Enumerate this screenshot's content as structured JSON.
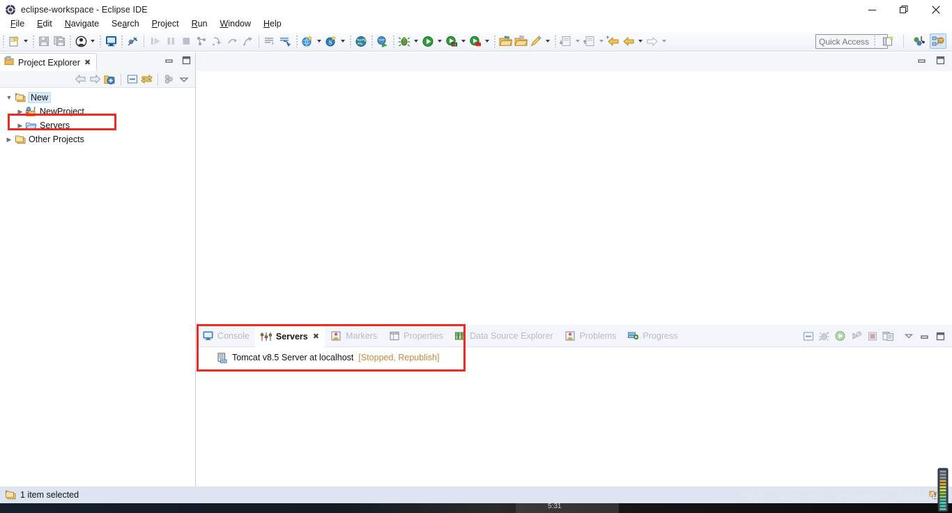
{
  "window": {
    "title": "eclipse-workspace - Eclipse IDE",
    "app_icon": "eclipse-icon",
    "minimize_label": "Minimize",
    "maximize_label": "Restore",
    "close_label": "Close"
  },
  "menu": {
    "items": [
      {
        "label": "File",
        "mnemonic": "F"
      },
      {
        "label": "Edit",
        "mnemonic": "E"
      },
      {
        "label": "Navigate",
        "mnemonic": "N"
      },
      {
        "label": "Search",
        "mnemonic": "a"
      },
      {
        "label": "Project",
        "mnemonic": "P"
      },
      {
        "label": "Run",
        "mnemonic": "R"
      },
      {
        "label": "Window",
        "mnemonic": "W"
      },
      {
        "label": "Help",
        "mnemonic": "H"
      }
    ]
  },
  "toolbar": {
    "quick_access_placeholder": "Quick Access",
    "quick_access_value": "",
    "items": [
      "new-wizard-icon",
      "new-dropdown-arrow",
      "save-icon",
      "save-all-icon",
      "user-icon",
      "user-dropdown-arrow",
      "open-console-icon",
      "toggle-breakpoint-icon",
      "resume-icon",
      "suspend-icon",
      "terminate-icon",
      "disconnect-icon",
      "step-into-icon",
      "step-over-icon",
      "step-return-icon",
      "skip-all-breakpoints-icon",
      "drop-to-frame-icon",
      "new-java-project-icon",
      "new-java-project-arrow",
      "new-servlet-icon",
      "new-servlet-arrow",
      "open-web-browser-icon",
      "run-web-app-icon",
      "debug-icon",
      "debug-arrow",
      "run-icon",
      "run-arrow",
      "run-server-icon",
      "run-server-arrow",
      "profile-icon",
      "profile-arrow",
      "new-folder-icon",
      "open-type-icon",
      "search-icon",
      "search-arrow",
      "next-annotation-icon",
      "next-annotation-arrow",
      "previous-annotation-icon",
      "previous-annotation-arrow",
      "back-icon",
      "back-arrow",
      "forward-icon",
      "forward-arrow"
    ],
    "perspective_buttons": [
      "open-perspective-icon",
      "java-ee-perspective-icon",
      "web-perspective-icon"
    ]
  },
  "project_explorer": {
    "tab_label": "Project Explorer",
    "tab_icon": "project-explorer-icon",
    "tab_close_label": "✖",
    "view_buttons": [
      "minimize-view-icon",
      "maximize-view-icon"
    ],
    "toolbar_buttons": [
      "back-navigation-icon",
      "forward-navigation-icon",
      "collapse-home-icon",
      "collapse-all-icon",
      "link-with-editor-icon",
      "view-menu-filters-icon",
      "view-menu-icon"
    ],
    "tree": [
      {
        "label": "New",
        "icon": "working-set-icon",
        "expanded": true,
        "indent": 0,
        "selected": true,
        "twisty": "v"
      },
      {
        "label": "NewProject",
        "icon": "dynamic-web-project-icon",
        "expanded": false,
        "indent": 1,
        "selected": false,
        "twisty": ">"
      },
      {
        "label": "Servers",
        "icon": "servers-folder-icon",
        "expanded": false,
        "indent": 1,
        "selected": false,
        "twisty": ">",
        "highlight": true
      },
      {
        "label": "Other Projects",
        "icon": "working-set-icon",
        "expanded": false,
        "indent": 0,
        "selected": false,
        "twisty": ">"
      }
    ]
  },
  "editor_area": {
    "buttons": [
      "minimize-editor-icon",
      "maximize-editor-icon"
    ]
  },
  "bottom_panel": {
    "tabs": [
      {
        "label": "Console",
        "icon": "console-icon",
        "active": false,
        "closable": false
      },
      {
        "label": "Servers",
        "icon": "servers-view-icon",
        "active": true,
        "closable": true
      },
      {
        "label": "Markers",
        "icon": "markers-icon",
        "active": false,
        "closable": false
      },
      {
        "label": "Properties",
        "icon": "properties-icon",
        "active": false,
        "closable": false
      },
      {
        "label": "Data Source Explorer",
        "icon": "data-source-explorer-icon",
        "active": false,
        "closable": false
      },
      {
        "label": "Problems",
        "icon": "problems-icon",
        "active": false,
        "closable": false
      },
      {
        "label": "Progress",
        "icon": "progress-icon",
        "active": false,
        "closable": false
      }
    ],
    "tab_close_label": "✖",
    "toolbar_buttons": [
      "collapse-all-icon",
      "debug-server-icon",
      "start-server-icon",
      "profile-server-icon",
      "stop-server-icon",
      "publish-server-icon",
      "view-menu-icon",
      "minimize-panel-icon",
      "maximize-panel-icon"
    ],
    "servers": [
      {
        "icon": "tomcat-server-icon",
        "name": "Tomcat v8.5 Server at localhost",
        "state": "[Stopped, Republish]"
      }
    ]
  },
  "status_bar": {
    "icon": "working-set-icon",
    "text": "1 item selected",
    "right_icon": "remote-system-icon"
  },
  "watermark": {
    "text": "https://blog.csdn.net/weixin_44644403"
  },
  "taskbar": {
    "clock": "5:31"
  },
  "colors": {
    "accent_red": "#ef2a22",
    "selection_blue": "#d4e8f7",
    "status_orange": "#c48a3a",
    "toolbar_bg": "#eef1f7",
    "statusbar_bg": "#dfe4f1"
  }
}
